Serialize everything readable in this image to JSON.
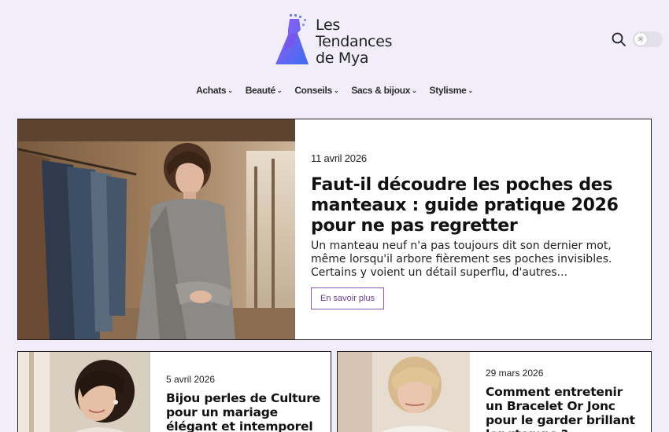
{
  "brand": {
    "name_line1": "Les",
    "name_line2": "Tendances",
    "name_line3": "de Mya",
    "logo_icon": "dress-icon",
    "colors": {
      "gradient_start": "#8a5cf6",
      "gradient_end": "#3b6df0"
    }
  },
  "header": {
    "search_icon": "search-icon",
    "theme_toggle_icon": "sun-icon"
  },
  "nav": {
    "items": [
      {
        "label": "Achats"
      },
      {
        "label": "Beauté"
      },
      {
        "label": "Conseils"
      },
      {
        "label": "Sacs & bijoux"
      },
      {
        "label": "Stylisme"
      }
    ]
  },
  "hero": {
    "date": "11 avril 2026",
    "title": "Faut-il découdre les poches des manteaux : guide pratique 2026 pour ne pas regretter",
    "excerpt": "Un manteau neuf n'a pas toujours dit son dernier mot, même lorsqu'il arbore fièrement ses poches invisibles. Certains y voient un détail superflu, d'autres...",
    "button_label": "En savoir plus"
  },
  "cards": [
    {
      "date": "5 avril 2026",
      "title": "Bijou perles de Culture pour un mariage élégant et intemporel"
    },
    {
      "date": "29 mars 2026",
      "title": "Comment entretenir un Bracelet Or Jonc pour le garder brillant longtemps ?"
    }
  ],
  "colors": {
    "page_bg": "#f1eefa",
    "accent": "#8a5ab8"
  }
}
